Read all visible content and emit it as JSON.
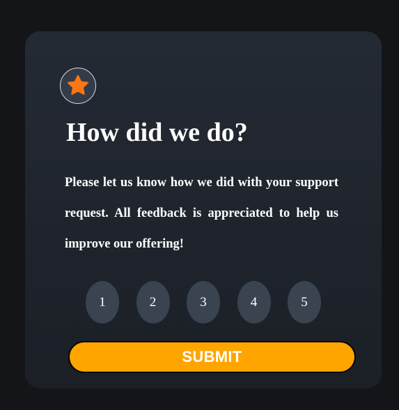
{
  "card": {
    "icon": "star-icon",
    "title": "How did we do?",
    "description": "Please let us know how we did with your support request. All feedback is appreciated to help us improve our offering!"
  },
  "ratings": [
    "1",
    "2",
    "3",
    "4",
    "5"
  ],
  "submit_label": "SUBMIT",
  "colors": {
    "page_background": "#141518",
    "card_background": "#242a34",
    "star": "#fc7614",
    "rating_background": "#3a4350",
    "submit_background": "#ffa500",
    "text": "#ffffff"
  }
}
